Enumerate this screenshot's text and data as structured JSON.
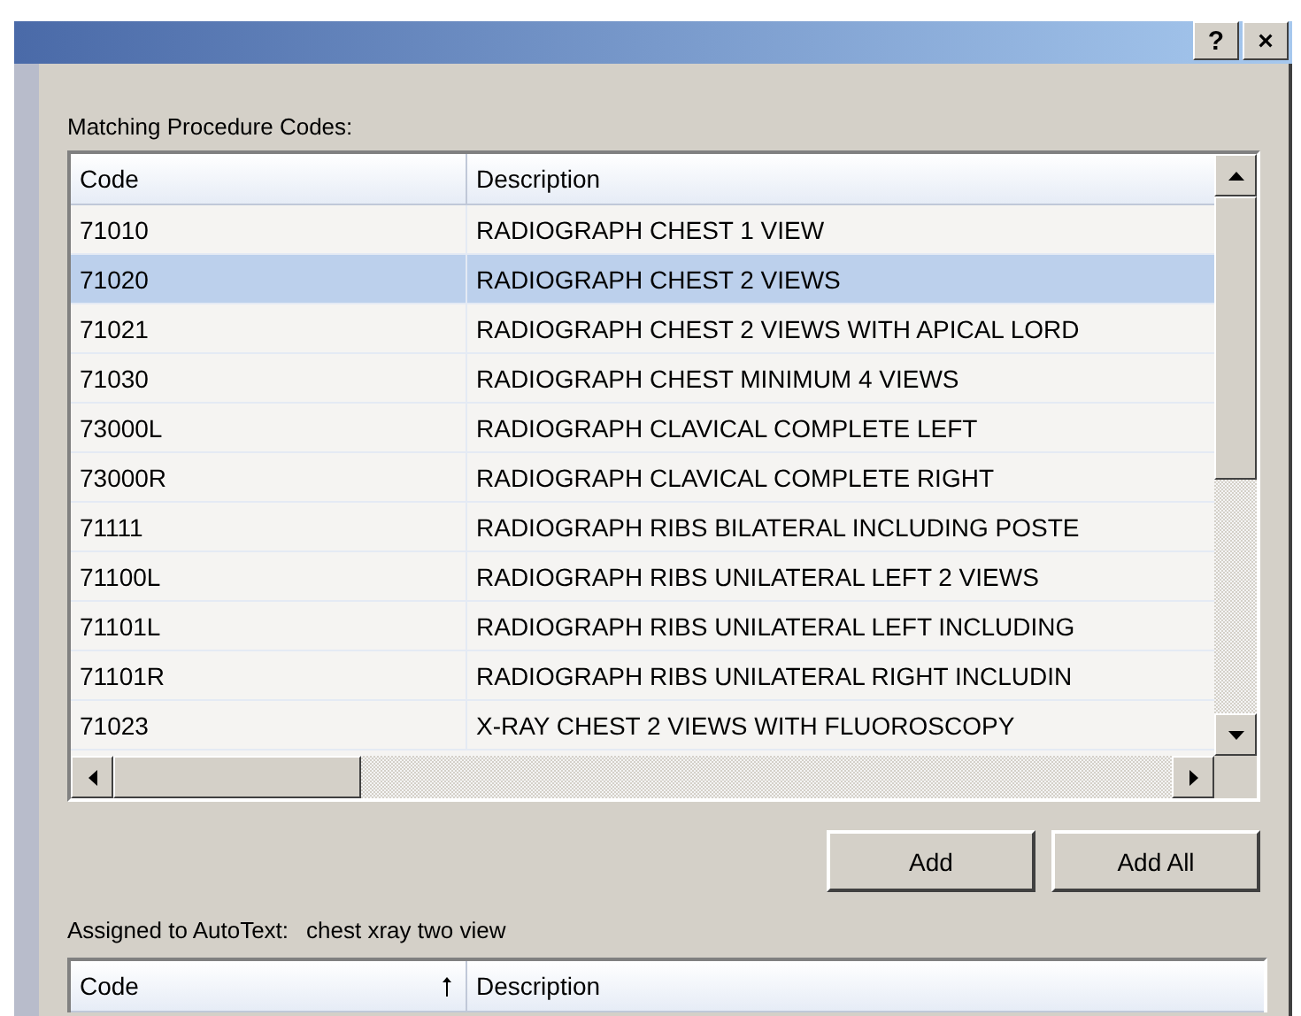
{
  "title_bar": {
    "buttons": [
      "?",
      "×"
    ]
  },
  "matching": {
    "label": "Matching Procedure Codes:",
    "columns": [
      "Code",
      "Description"
    ],
    "rows": [
      {
        "code": "71010",
        "description": "RADIOGRAPH CHEST 1 VIEW",
        "selected": false
      },
      {
        "code": "71020",
        "description": "RADIOGRAPH CHEST 2 VIEWS",
        "selected": true
      },
      {
        "code": "71021",
        "description": "RADIOGRAPH CHEST 2 VIEWS WITH APICAL LORD",
        "selected": false
      },
      {
        "code": "71030",
        "description": "RADIOGRAPH CHEST MINIMUM 4 VIEWS",
        "selected": false
      },
      {
        "code": "73000L",
        "description": "RADIOGRAPH CLAVICAL COMPLETE LEFT",
        "selected": false
      },
      {
        "code": "73000R",
        "description": "RADIOGRAPH CLAVICAL COMPLETE RIGHT",
        "selected": false
      },
      {
        "code": "71111",
        "description": "RADIOGRAPH RIBS BILATERAL INCLUDING POSTE",
        "selected": false
      },
      {
        "code": "71100L",
        "description": "RADIOGRAPH RIBS UNILATERAL LEFT 2 VIEWS",
        "selected": false
      },
      {
        "code": "71101L",
        "description": "RADIOGRAPH RIBS UNILATERAL LEFT INCLUDING",
        "selected": false
      },
      {
        "code": "71101R",
        "description": "RADIOGRAPH RIBS UNILATERAL RIGHT INCLUDIN",
        "selected": false
      },
      {
        "code": "71023",
        "description": "X-RAY CHEST 2 VIEWS WITH FLUOROSCOPY",
        "selected": false
      }
    ]
  },
  "buttons": [
    "Add",
    "Add All"
  ],
  "assigned": {
    "label": "Assigned to AutoText:",
    "value": "chest xray two view",
    "columns": [
      "Code",
      "Description"
    ]
  }
}
